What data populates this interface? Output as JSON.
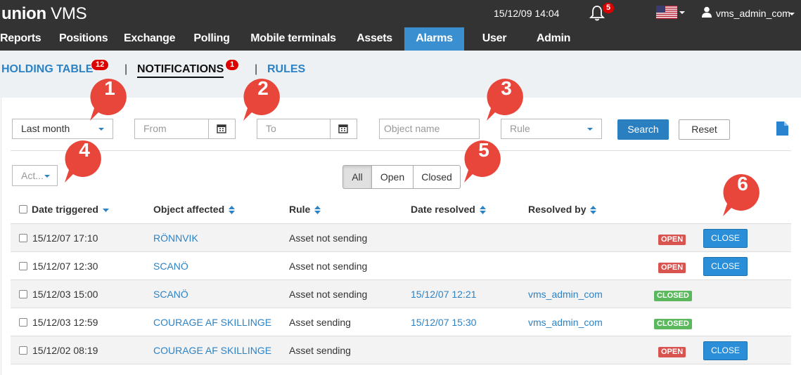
{
  "app": {
    "logo_bold": "union",
    "logo_light": " VMS",
    "datetime": "15/12/09 14:04",
    "notification_count": "5",
    "user": "vms_admin_com",
    "flag_icon": "us-flag-icon"
  },
  "nav": {
    "items": [
      {
        "label": "Reports",
        "active": false
      },
      {
        "label": "Positions",
        "active": false
      },
      {
        "label": "Exchange",
        "active": false
      },
      {
        "label": "Polling",
        "active": false
      },
      {
        "label": "Mobile terminals",
        "active": false
      },
      {
        "label": "Assets",
        "active": false
      },
      {
        "label": "Alarms",
        "active": true
      },
      {
        "label": "User",
        "active": false
      },
      {
        "label": "Admin",
        "active": false
      }
    ]
  },
  "subtabs": {
    "holding": {
      "label": "HOLDING TABLE",
      "badge": "12"
    },
    "notifications": {
      "label": "NOTIFICATIONS",
      "badge": "1"
    },
    "rules": {
      "label": "RULES"
    },
    "separator": "|"
  },
  "filters": {
    "period": "Last month",
    "from_placeholder": "From",
    "to_placeholder": "To",
    "object_placeholder": "Object name",
    "rule_placeholder": "Rule",
    "search_label": "Search",
    "reset_label": "Reset"
  },
  "actions": {
    "label": "Act..."
  },
  "segments": {
    "all": "All",
    "open": "Open",
    "closed": "Closed",
    "selected": "All"
  },
  "table": {
    "headers": {
      "date": "Date triggered",
      "object": "Object affected",
      "rule": "Rule",
      "resolved": "Date resolved",
      "resolved_by": "Resolved by"
    },
    "rows": [
      {
        "date": "15/12/07 17:10",
        "object": "RÖNNVIK",
        "rule": "Asset not sending",
        "resolved": "",
        "resolved_by": "",
        "status": "OPEN",
        "action": "CLOSE"
      },
      {
        "date": "15/12/07 12:30",
        "object": "SCANÖ",
        "rule": "Asset not sending",
        "resolved": "",
        "resolved_by": "",
        "status": "OPEN",
        "action": "CLOSE"
      },
      {
        "date": "15/12/03 15:00",
        "object": "SCANÖ",
        "rule": "Asset not sending",
        "resolved": "15/12/07 12:21",
        "resolved_by": "vms_admin_com",
        "status": "CLOSED",
        "action": ""
      },
      {
        "date": "15/12/03 12:59",
        "object": "COURAGE AF SKILLINGE",
        "rule": "Asset sending",
        "resolved": "15/12/07 15:30",
        "resolved_by": "vms_admin_com",
        "status": "CLOSED",
        "action": ""
      },
      {
        "date": "15/12/02 08:19",
        "object": "COURAGE AF SKILLINGE",
        "rule": "Asset sending",
        "resolved": "",
        "resolved_by": "",
        "status": "OPEN",
        "action": "CLOSE"
      }
    ]
  },
  "markers": [
    "1",
    "2",
    "3",
    "4",
    "5",
    "6"
  ],
  "colors": {
    "accent": "#3a8fd0",
    "link": "#2b83c6",
    "open": "#d9534f",
    "closed": "#5cb85c",
    "marker": "#e8463a"
  }
}
